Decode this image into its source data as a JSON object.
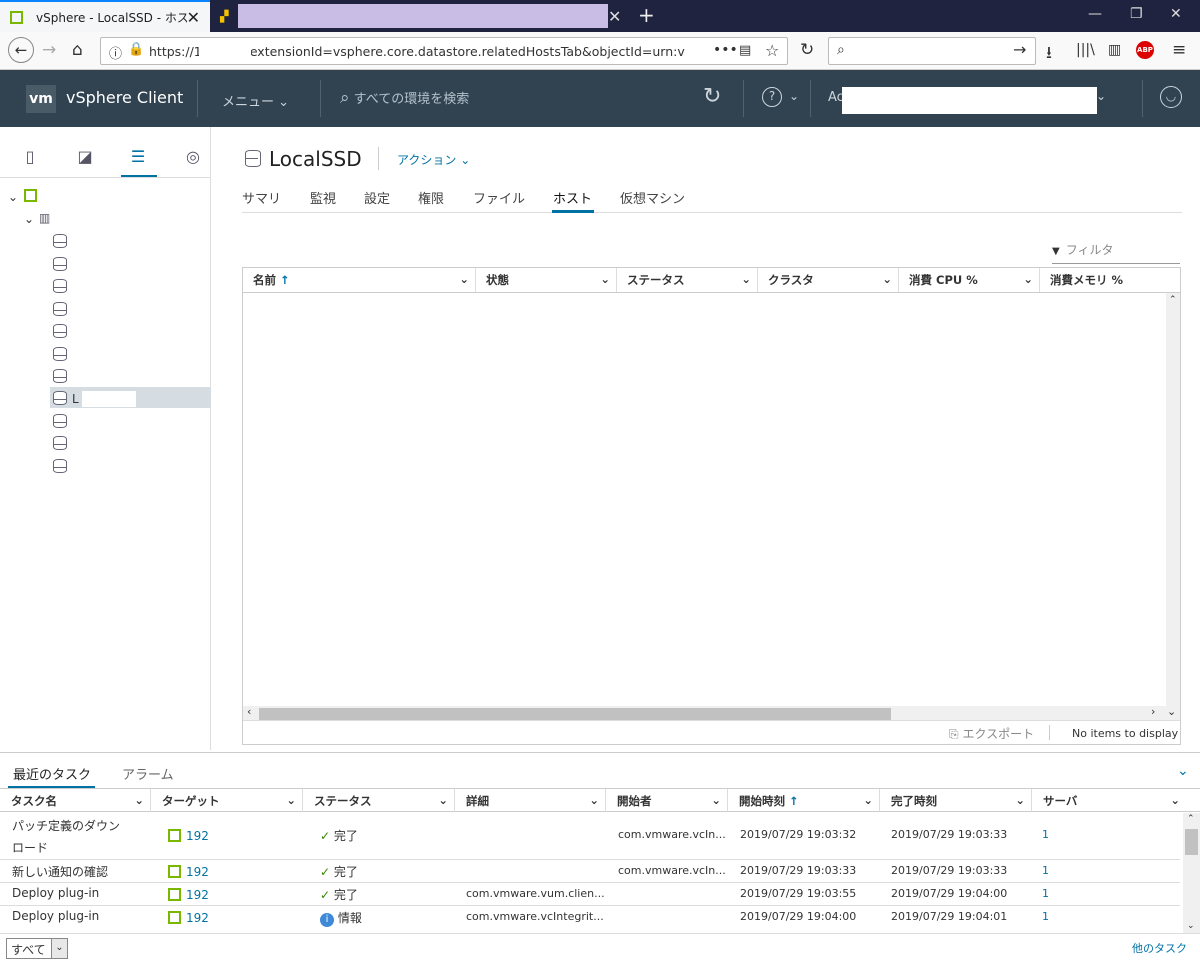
{
  "browser": {
    "tab1_title": "vSphere - LocalSSD - ホスト",
    "url": "https://19          'ui/#?extensionId=vsphere.core.datastore.relatedHostsTab&objectId=urn:v",
    "new_tab": "+"
  },
  "header": {
    "logo": "vm",
    "app_name": "vSphere Client",
    "menu": "メニュー",
    "search_placeholder": "すべての環境を検索",
    "account_prefix": "Ac"
  },
  "sidebar": {
    "selected_label": "L"
  },
  "object": {
    "title": "LocalSSD",
    "actions": "アクション"
  },
  "tabs": [
    "サマリ",
    "監視",
    "設定",
    "権限",
    "ファイル",
    "ホスト",
    "仮想マシン"
  ],
  "active_tab": "ホスト",
  "filter_placeholder": "フィルタ",
  "grid": {
    "columns": [
      "名前",
      "状態",
      "ステータス",
      "クラスタ",
      "消費 CPU %",
      "消費メモリ %"
    ],
    "sort_indicator": "↑",
    "export": "エクスポート",
    "empty": "No items to display"
  },
  "bottom": {
    "tab_tasks": "最近のタスク",
    "tab_alarms": "アラーム",
    "columns": [
      "タスク名",
      "ターゲット",
      "ステータス",
      "詳細",
      "開始者",
      "開始時刻",
      "完了時刻",
      "サーバ"
    ],
    "rows": [
      {
        "name1": "パッチ定義のダウン",
        "name2": "ロード",
        "target": "192",
        "status": "完了",
        "detail": "",
        "initiator": "com.vmware.vcIn...",
        "start": "2019/07/29 19:03:32",
        "end": "2019/07/29 19:03:33",
        "server": "1"
      },
      {
        "name1": "新しい通知の確認",
        "target": "192",
        "status": "完了",
        "detail": "",
        "initiator": "com.vmware.vcIn...",
        "start": "2019/07/29 19:03:33",
        "end": "2019/07/29 19:03:33",
        "server": "1"
      },
      {
        "name1": "Deploy plug-in",
        "target": "192",
        "status": "完了",
        "detail": "com.vmware.vum.clien...",
        "initiator": "",
        "start": "2019/07/29 19:03:55",
        "end": "2019/07/29 19:04:00",
        "server": "1"
      },
      {
        "name1": "Deploy plug-in",
        "target": "192",
        "status": "情報",
        "detail": "com.vmware.vcIntegrit...",
        "initiator": "",
        "start": "2019/07/29 19:04:00",
        "end": "2019/07/29 19:04:01",
        "server": "1"
      }
    ],
    "select_value": "すべて",
    "more_tasks": "他のタスク"
  },
  "colors": {
    "accent": "#0072a3",
    "header_bg": "#314351",
    "host_green": "#7ab800"
  }
}
